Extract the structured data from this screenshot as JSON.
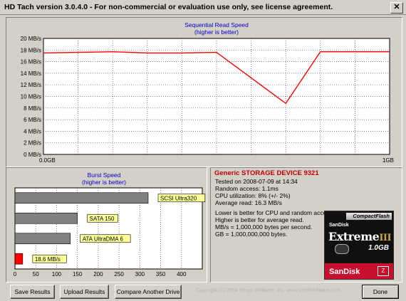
{
  "window": {
    "title": "HD Tach version 3.0.4.0  - For non-commercial or evaluation use only, see license agreement.",
    "close_glyph": "✕"
  },
  "seq_chart": {
    "title": "Sequential Read Speed",
    "subtitle": "(higher is better)",
    "x_start_label": "0.0GB",
    "x_end_label": "1GB",
    "unit": "MB/s"
  },
  "burst_chart": {
    "title": "Burst Speed",
    "subtitle": "(higher is better)"
  },
  "info": {
    "device_name": "Generic STORAGE DEVICE 9321",
    "tested": "Tested on 2008-07-09 at 14:34",
    "random_access": "Random access: 1.1ms",
    "cpu": "CPU utilization: 8% (+/- 2%)",
    "avg_read": "Average read: 16.3 MB/s",
    "note1": "Lower is better for CPU and random access.",
    "note2": "Higher is better for average read.",
    "note3": "MB/s = 1,000,000 bytes per second.",
    "note4": "GB = 1,000,000,000 bytes."
  },
  "card": {
    "compactflash": "CompactFlash",
    "brand_small": "SanDisk",
    "line": "Extreme",
    "line_suffix": "III",
    "capacity": "1.0GB",
    "brand_large": "SanDisk"
  },
  "buttons": {
    "save": "Save Results",
    "upload": "Upload Results",
    "compare": "Compare Another Drive",
    "done": "Done"
  },
  "copyright": "Copyright (C) 2004 Simpli Software, Inc. www.simplisoftware.com",
  "colors": {
    "grid": "#c0c0c0",
    "seq_line": "#ff0000",
    "bar_ref": "#808080",
    "bar_device": "#ff0000",
    "label_bg": "#ffff99",
    "chart_bg": "#ffffff"
  },
  "chart_data": [
    {
      "type": "line",
      "title": "Sequential Read Speed",
      "subtitle": "(higher is better)",
      "xlabel": "",
      "ylabel": "",
      "x": [
        0.0,
        0.1,
        0.2,
        0.3,
        0.4,
        0.5,
        0.6,
        0.7,
        0.8,
        0.9,
        1.0
      ],
      "series": [
        {
          "values": [
            17.5,
            17.6,
            17.7,
            17.5,
            17.5,
            17.6,
            13.2,
            8.8,
            17.7,
            17.7,
            17.7
          ]
        }
      ],
      "x_tick_labels": [
        "0.0GB",
        "1GB"
      ],
      "yticks": [
        "0 MB/s",
        "2 MB/s",
        "4 MB/s",
        "6 MB/s",
        "8 MB/s",
        "10 MB/s",
        "12 MB/s",
        "14 MB/s",
        "16 MB/s",
        "18 MB/s",
        "20 MB/s"
      ],
      "ylim": [
        0,
        20
      ],
      "xlim": [
        0,
        1
      ],
      "grid": true
    },
    {
      "type": "bar",
      "orientation": "horizontal",
      "title": "Burst Speed",
      "subtitle": "(higher is better)",
      "categories": [
        "SCSI Ultra320",
        "SATA 150",
        "ATA UltraDMA 6",
        "18.6 MB/s"
      ],
      "values": [
        320,
        150,
        133,
        18.6
      ],
      "xticks": [
        0,
        50,
        100,
        150,
        200,
        250,
        300,
        350,
        400
      ],
      "xlim": [
        0,
        450
      ],
      "grid": true
    }
  ]
}
